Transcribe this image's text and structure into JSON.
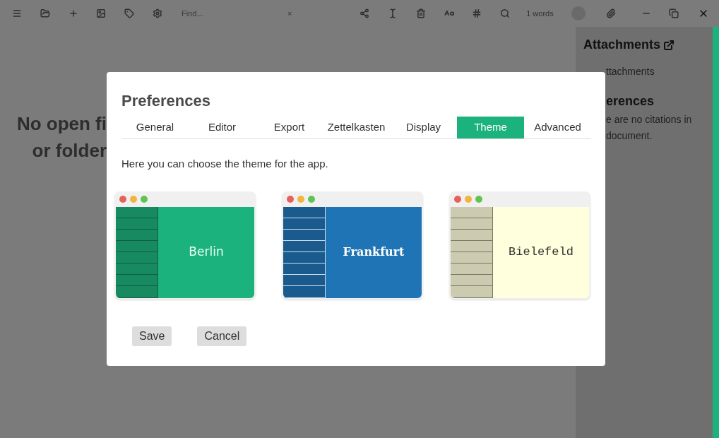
{
  "toolbar": {
    "search": {
      "placeholder": "Find..."
    },
    "clear": "×",
    "word_count": "1 words"
  },
  "editor": {
    "empty_lines": [
      "No open fi",
      "or folder"
    ]
  },
  "sidebar": {
    "attachments_title": "Attachments",
    "attachments_text": "ttachments",
    "references_title": "erences",
    "references_text": [
      "e are no citations in",
      "document."
    ]
  },
  "dialog": {
    "title": "Preferences",
    "tabs": [
      {
        "label": "General",
        "selected": false
      },
      {
        "label": "Editor",
        "selected": false
      },
      {
        "label": "Export",
        "selected": false
      },
      {
        "label": "Zettelkasten",
        "selected": false
      },
      {
        "label": "Display",
        "selected": false
      },
      {
        "label": "Theme",
        "selected": true
      },
      {
        "label": "Advanced",
        "selected": false
      }
    ],
    "description": "Here you can choose the theme for the app.",
    "themes": [
      {
        "name": "Berlin",
        "kind": "berlin"
      },
      {
        "name": "Frankfurt",
        "kind": "frankfurt"
      },
      {
        "name": "Bielefeld",
        "kind": "bielefeld"
      }
    ],
    "buttons": [
      "Save",
      "Cancel"
    ]
  }
}
